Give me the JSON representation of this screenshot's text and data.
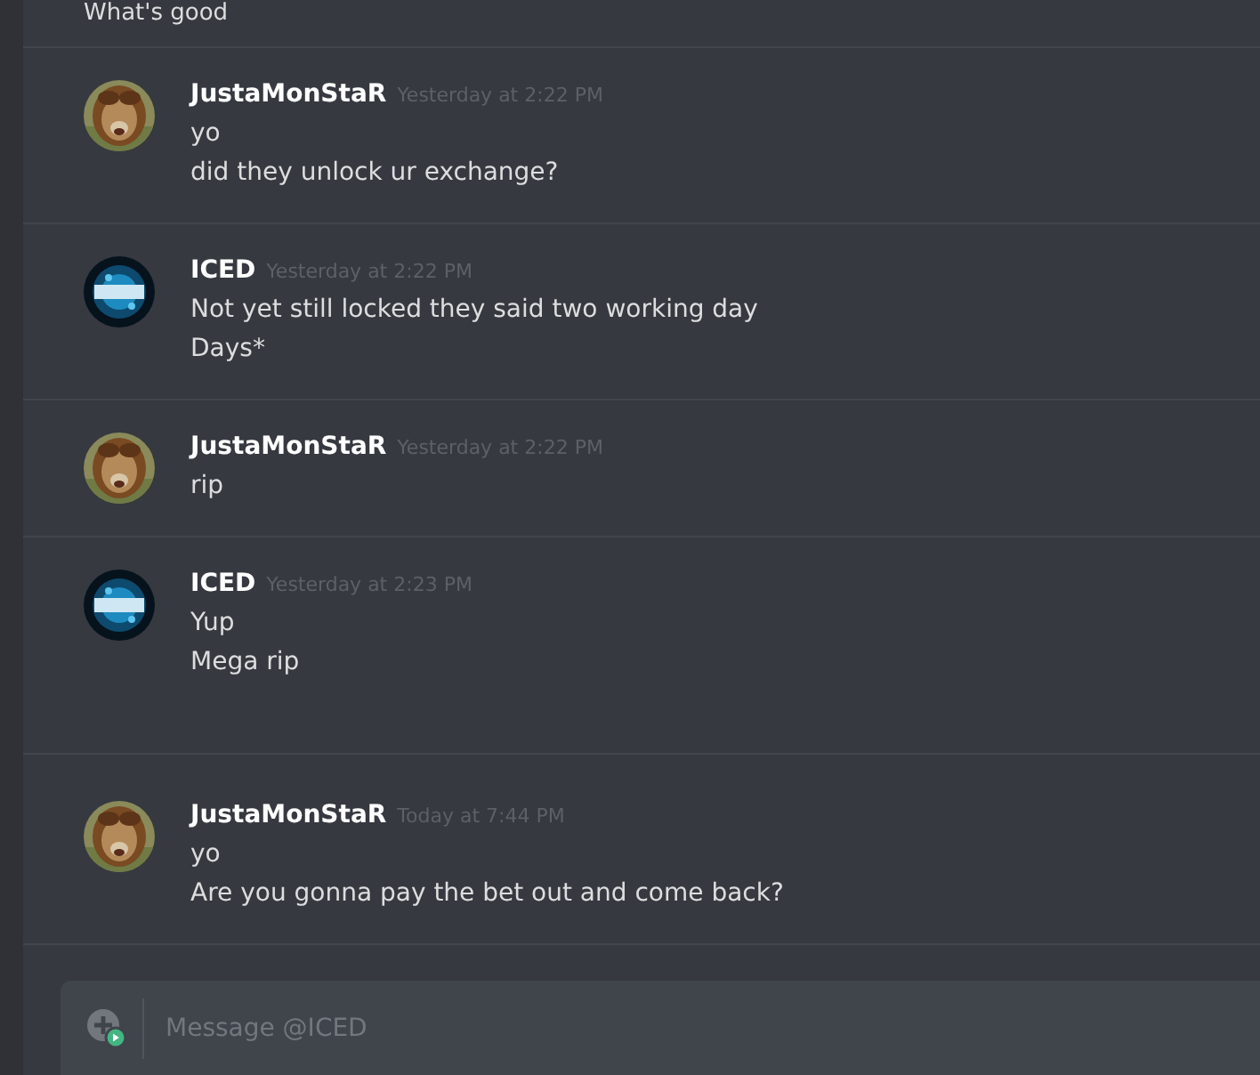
{
  "top_message": {
    "text": "What's good"
  },
  "messages": [
    {
      "author": "JustaMonStaR",
      "timestamp": "Yesterday at 2:22 PM",
      "lines": [
        "yo",
        "did they unlock ur exchange?"
      ]
    },
    {
      "author": "ICED",
      "timestamp": "Yesterday at 2:22 PM",
      "lines": [
        "Not yet still locked they said two working day",
        "Days*"
      ]
    },
    {
      "author": "JustaMonStaR",
      "timestamp": "Yesterday at 2:22 PM",
      "lines": [
        "rip"
      ]
    },
    {
      "author": "ICED",
      "timestamp": "Yesterday at 2:23 PM",
      "lines": [
        "Yup",
        "Mega rip"
      ]
    },
    {
      "author": "JustaMonStaR",
      "timestamp": "Today at 7:44 PM",
      "lines": [
        "yo",
        "Are you gonna pay the bet out and come back?"
      ]
    }
  ],
  "composer": {
    "placeholder": "Message @ICED"
  }
}
